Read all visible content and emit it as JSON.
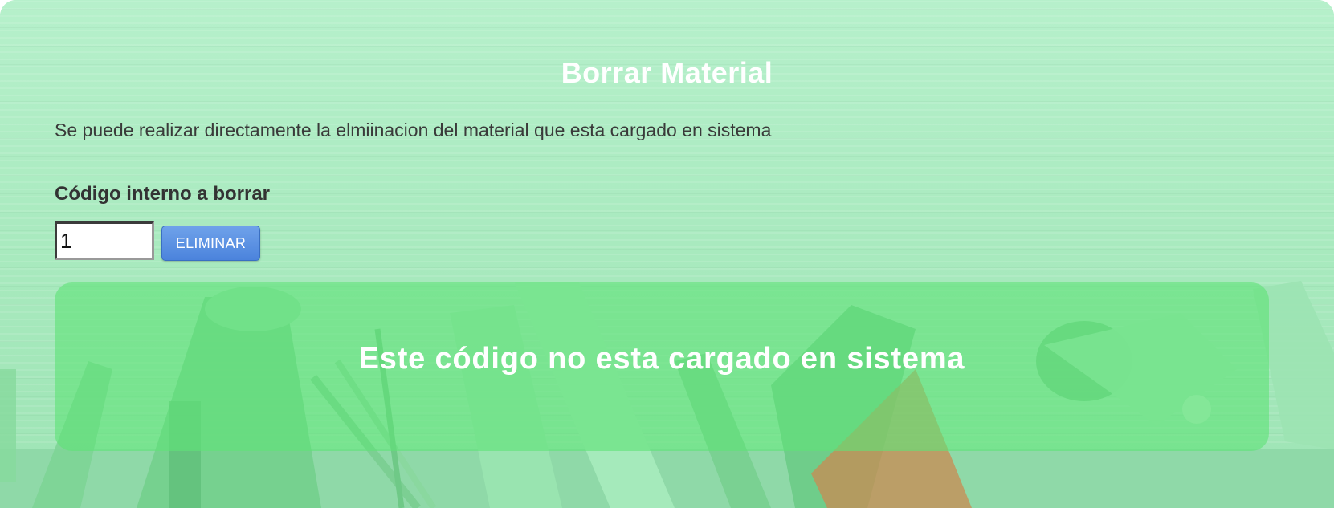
{
  "page": {
    "title": "Borrar Material",
    "description": "Se puede realizar directamente la elmiinacion del material que esta cargado en sistema"
  },
  "form": {
    "label": "Código interno a borrar",
    "code_value": "1",
    "button_label": "ELIMINAR"
  },
  "alert": {
    "message": "Este código no esta cargado en sistema"
  },
  "colors": {
    "background_tint": "#a9ecc0",
    "alert_panel": "#60e278",
    "button": "#4b83dc",
    "title_text": "#ffffff"
  },
  "icons": {
    "background_illustration": "tools-background"
  }
}
